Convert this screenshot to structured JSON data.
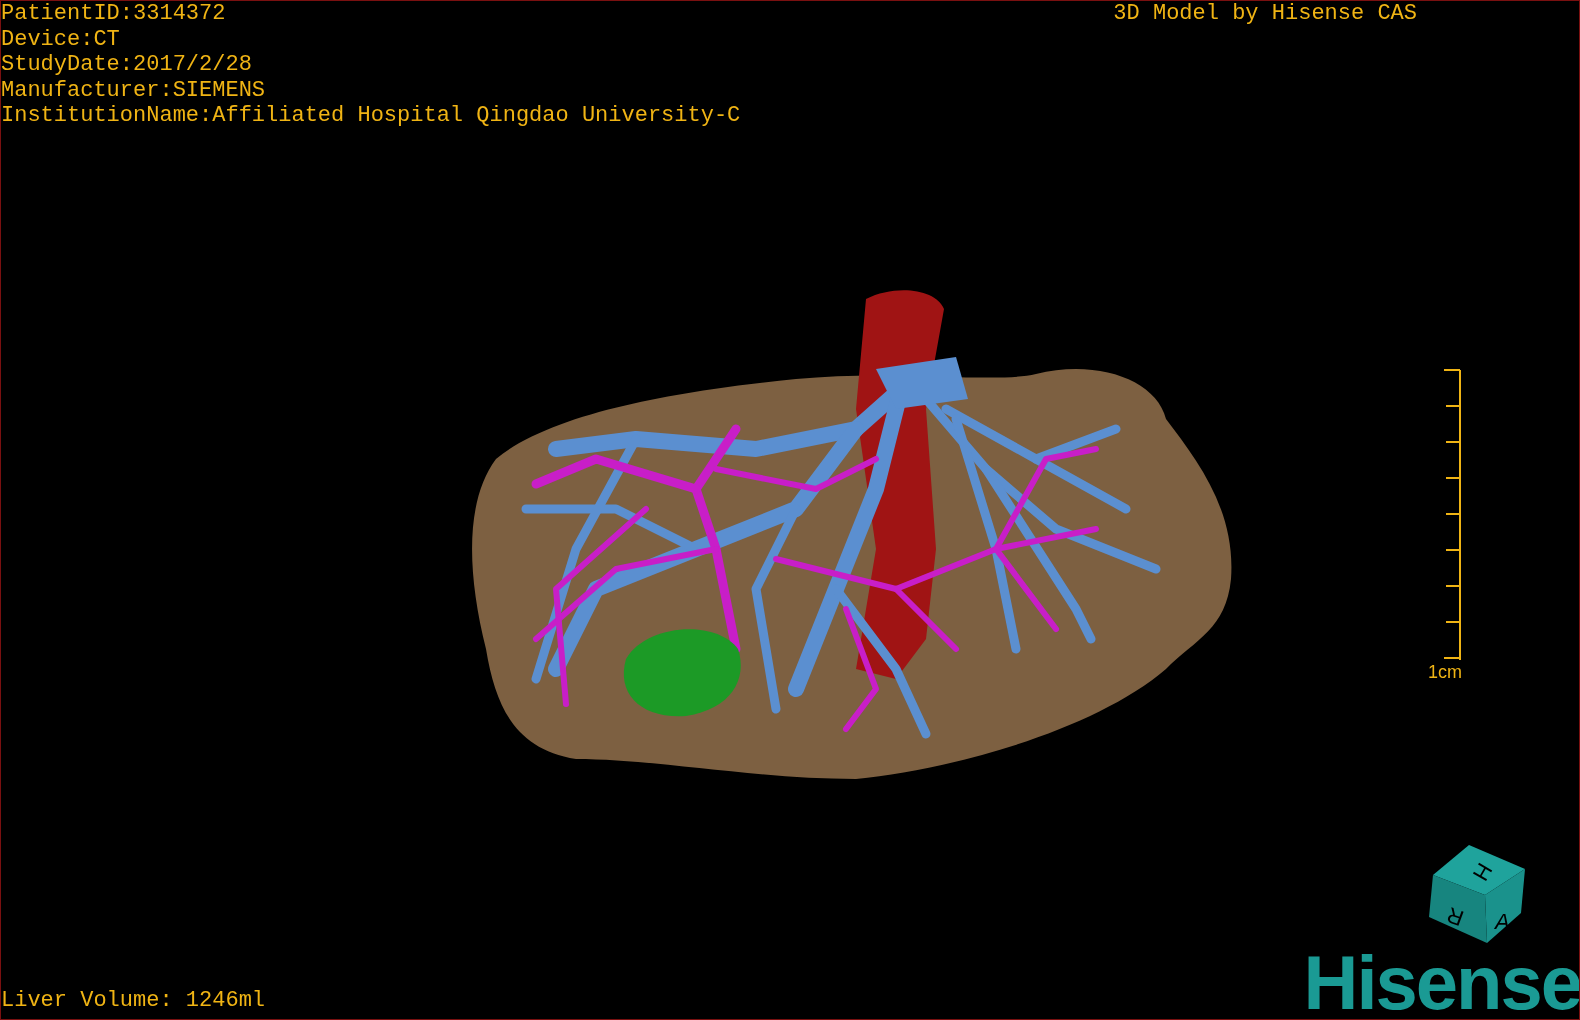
{
  "study_info": [
    "PatientID:3314372",
    "Device:CT",
    "StudyDate:2017/2/28",
    "Manufacturer:SIEMENS",
    "InstitutionName:Affiliated Hospital Qingdao University-C"
  ],
  "credit": "3D Model by Hisense CAS",
  "scale_bar": {
    "label": "1cm"
  },
  "orientation_cube": {
    "labels": [
      "H",
      "R",
      "A"
    ]
  },
  "liver_volume": "Liver Volume: 1246ml",
  "logo": "Hisense"
}
